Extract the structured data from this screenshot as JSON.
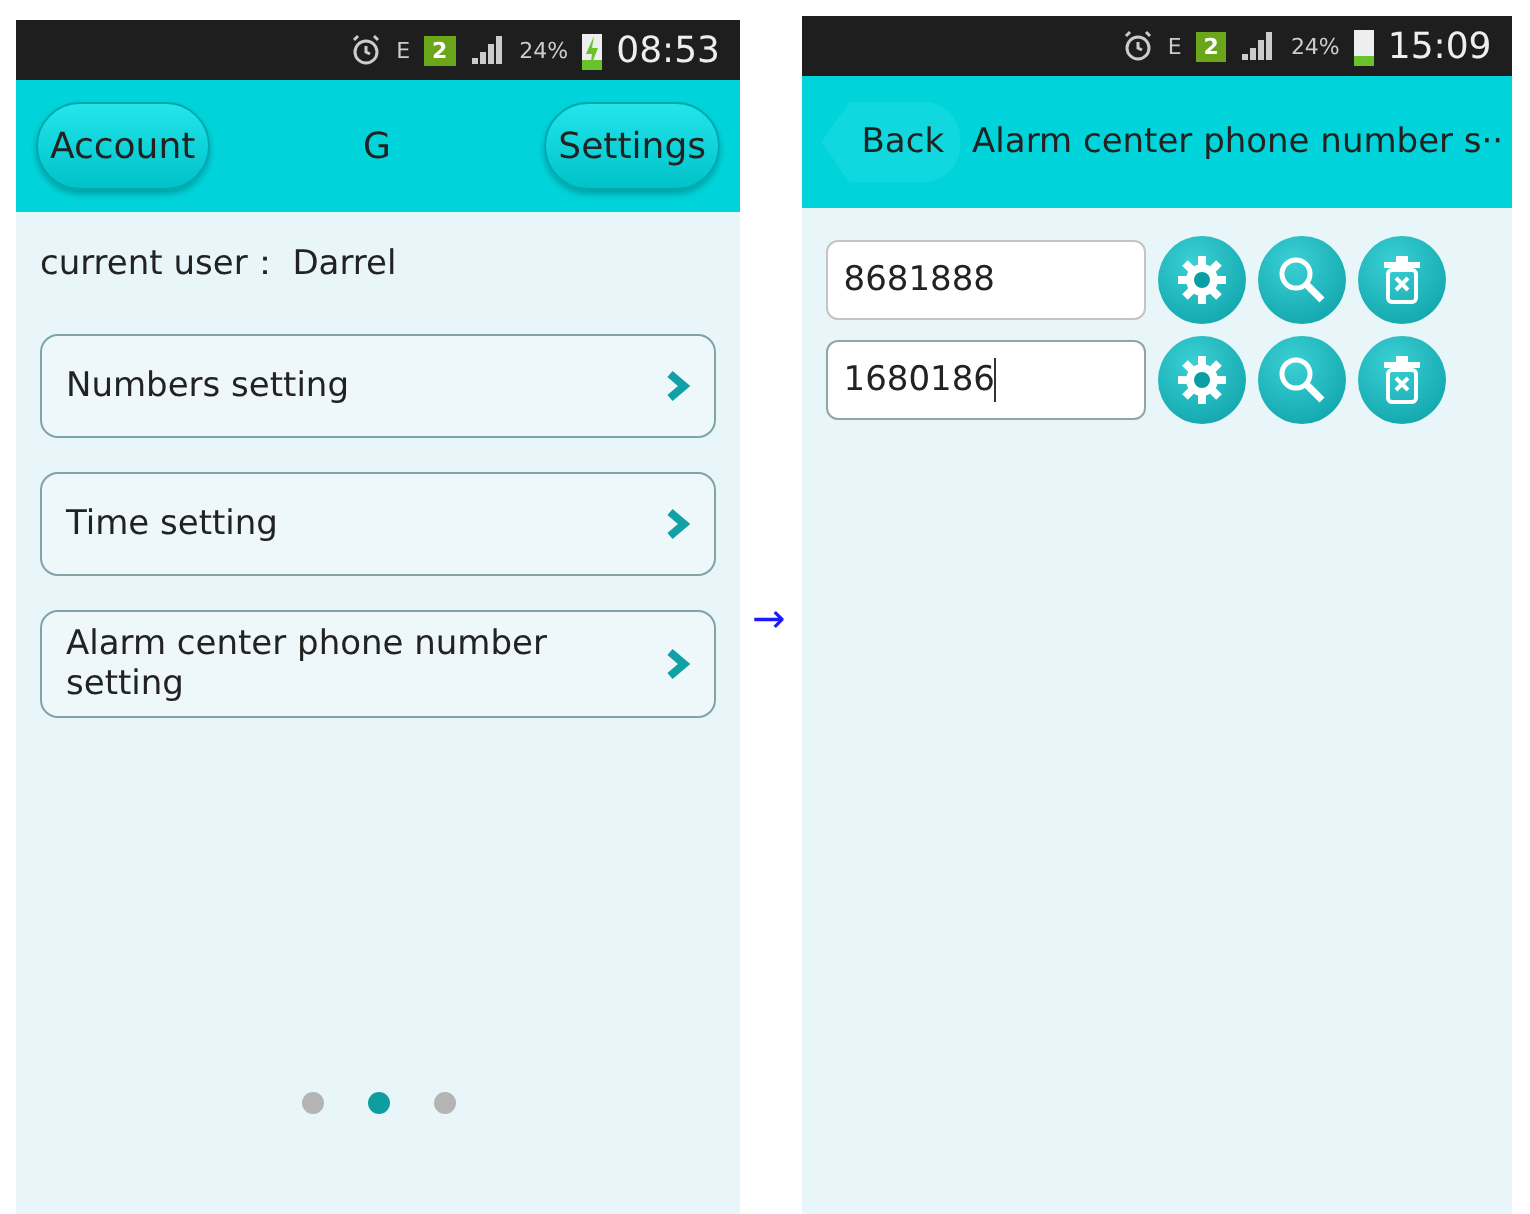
{
  "screens": [
    {
      "status_bar": {
        "network": "E",
        "sim": "2",
        "battery": "24%",
        "charging": true,
        "time": "08:53"
      },
      "header": {
        "kind": "home",
        "left_button": "Account",
        "title": "G",
        "right_button": "Settings"
      },
      "current_user": "current user：  Darrel",
      "menu": [
        {
          "label": "Numbers setting"
        },
        {
          "label": "Time setting"
        },
        {
          "label": "Alarm center phone number setting"
        }
      ],
      "pager": [
        {
          "selected": false
        },
        {
          "selected": true
        },
        {
          "selected": false
        }
      ]
    },
    {
      "status_bar": {
        "network": "E",
        "sim": "2",
        "battery": "24%",
        "charging": false,
        "time": "15:09"
      },
      "header": {
        "kind": "back",
        "back_button": "Back",
        "title": "Alarm center phone number s··"
      },
      "numbers": [
        {
          "value": "8681888",
          "focused": false
        },
        {
          "value": "1680186",
          "focused": true
        }
      ]
    }
  ],
  "arrow": "→"
}
